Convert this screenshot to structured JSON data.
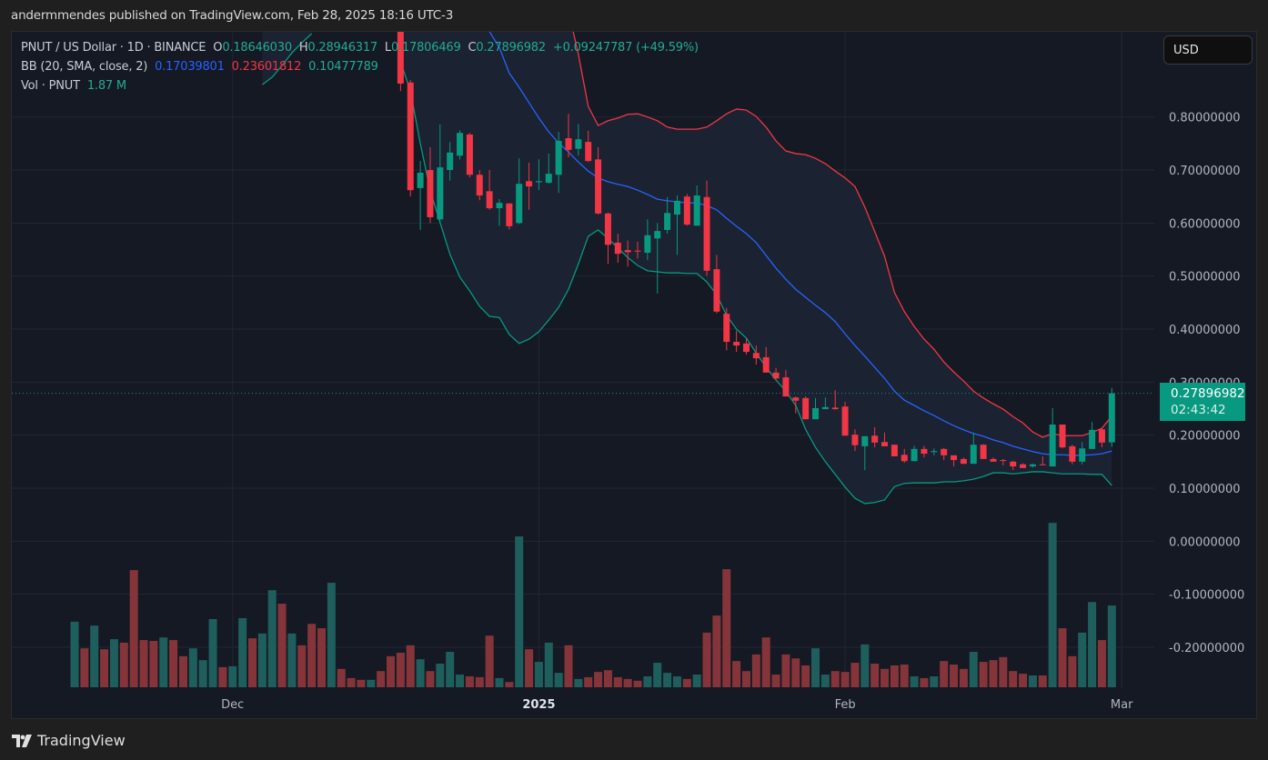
{
  "header": {
    "publisher": "andermmendes published on TradingView.com, Feb 28, 2025 18:16 UTC-3"
  },
  "legend": {
    "symbol": "PNUT / US Dollar · 1D · BINANCE",
    "o_label": "O",
    "o": "0.18646030",
    "h_label": "H",
    "h": "0.28946317",
    "l_label": "L",
    "l": "0.17806469",
    "c_label": "C",
    "c": "0.27896982",
    "change": "+0.09247787 (+49.59%)",
    "bb_label": "BB (20, SMA, close, 2)",
    "bb_basis": "0.17039801",
    "bb_upper": "0.23601812",
    "bb_lower": "0.10477789",
    "vol_label": "Vol · PNUT",
    "vol": "1.87 M"
  },
  "currency_button": "USD",
  "last_price": {
    "price": "0.27896982",
    "countdown": "02:43:42",
    "value": 0.27896982
  },
  "branding": {
    "name": "TradingView"
  },
  "colors": {
    "up": "#089981",
    "down": "#f23645",
    "vol_up": "#1e5f5d",
    "vol_down": "#853539",
    "bb_basis": "#2962ff",
    "bb_upper": "#f23645",
    "bb_lower": "#089981",
    "band_fill": "#1c2333"
  },
  "chart_data": {
    "type": "candlestick",
    "title": "PNUT / US Dollar · 1D · BINANCE",
    "ylim": [
      -0.25,
      0.96
    ],
    "y_ticks": [
      {
        "value": 0.8,
        "label": "0.80000000"
      },
      {
        "value": 0.7,
        "label": "0.70000000"
      },
      {
        "value": 0.6,
        "label": "0.60000000"
      },
      {
        "value": 0.5,
        "label": "0.50000000"
      },
      {
        "value": 0.4,
        "label": "0.40000000"
      },
      {
        "value": 0.3,
        "label": "0.30000000"
      },
      {
        "value": 0.2,
        "label": "0.20000000"
      },
      {
        "value": 0.1,
        "label": "0.10000000"
      },
      {
        "value": 0.0,
        "label": "0.00000000"
      },
      {
        "value": -0.1,
        "label": "-0.10000000"
      },
      {
        "value": -0.2,
        "label": "-0.20000000"
      }
    ],
    "x_ticks": [
      {
        "day": 16,
        "label": "Dec",
        "bold": false
      },
      {
        "day": 47,
        "label": "2025",
        "bold": true
      },
      {
        "day": 78,
        "label": "Feb",
        "bold": false
      },
      {
        "day": 106,
        "label": "Mar",
        "bold": false
      }
    ],
    "candle_offset": 33,
    "candles_ohlc": [
      [
        1.02,
        1.05,
        0.849,
        0.863
      ],
      [
        0.865,
        0.87,
        0.65,
        0.662
      ],
      [
        0.666,
        0.717,
        0.587,
        0.695
      ],
      [
        0.7,
        0.743,
        0.6,
        0.611
      ],
      [
        0.607,
        0.786,
        0.605,
        0.705
      ],
      [
        0.7,
        0.753,
        0.68,
        0.733
      ],
      [
        0.727,
        0.775,
        0.72,
        0.77
      ],
      [
        0.767,
        0.77,
        0.686,
        0.691
      ],
      [
        0.691,
        0.7,
        0.643,
        0.652
      ],
      [
        0.66,
        0.7,
        0.625,
        0.628
      ],
      [
        0.628,
        0.645,
        0.595,
        0.638
      ],
      [
        0.637,
        0.637,
        0.588,
        0.594
      ],
      [
        0.6,
        0.722,
        0.598,
        0.674
      ],
      [
        0.679,
        0.714,
        0.625,
        0.669
      ],
      [
        0.677,
        0.72,
        0.662,
        0.679
      ],
      [
        0.676,
        0.731,
        0.674,
        0.693
      ],
      [
        0.691,
        0.772,
        0.657,
        0.755
      ],
      [
        0.76,
        0.806,
        0.724,
        0.738
      ],
      [
        0.74,
        0.787,
        0.727,
        0.758
      ],
      [
        0.753,
        0.774,
        0.715,
        0.717
      ],
      [
        0.72,
        0.743,
        0.616,
        0.618
      ],
      [
        0.618,
        0.62,
        0.523,
        0.559
      ],
      [
        0.563,
        0.58,
        0.525,
        0.542
      ],
      [
        0.549,
        0.567,
        0.518,
        0.545
      ],
      [
        0.548,
        0.565,
        0.533,
        0.547
      ],
      [
        0.544,
        0.607,
        0.53,
        0.577
      ],
      [
        0.571,
        0.6,
        0.467,
        0.585
      ],
      [
        0.587,
        0.649,
        0.58,
        0.619
      ],
      [
        0.616,
        0.652,
        0.54,
        0.642
      ],
      [
        0.65,
        0.655,
        0.595,
        0.597
      ],
      [
        0.595,
        0.671,
        0.595,
        0.652
      ],
      [
        0.649,
        0.68,
        0.5,
        0.51
      ],
      [
        0.513,
        0.54,
        0.43,
        0.433
      ],
      [
        0.429,
        0.44,
        0.36,
        0.376
      ],
      [
        0.376,
        0.397,
        0.357,
        0.369
      ],
      [
        0.373,
        0.382,
        0.352,
        0.357
      ],
      [
        0.355,
        0.369,
        0.333,
        0.345
      ],
      [
        0.347,
        0.366,
        0.318,
        0.318
      ],
      [
        0.318,
        0.327,
        0.305,
        0.307
      ],
      [
        0.309,
        0.323,
        0.273,
        0.273
      ],
      [
        0.271,
        0.273,
        0.241,
        0.265
      ],
      [
        0.27,
        0.273,
        0.23,
        0.23
      ],
      [
        0.23,
        0.27,
        0.23,
        0.251
      ],
      [
        0.249,
        0.271,
        0.249,
        0.253
      ],
      [
        0.252,
        0.285,
        0.248,
        0.249
      ],
      [
        0.254,
        0.263,
        0.199,
        0.199
      ],
      [
        0.201,
        0.211,
        0.17,
        0.181
      ],
      [
        0.179,
        0.198,
        0.134,
        0.198
      ],
      [
        0.199,
        0.215,
        0.177,
        0.186
      ],
      [
        0.187,
        0.205,
        0.179,
        0.179
      ],
      [
        0.182,
        0.182,
        0.16,
        0.16
      ],
      [
        0.163,
        0.174,
        0.148,
        0.151
      ],
      [
        0.151,
        0.18,
        0.151,
        0.174
      ],
      [
        0.174,
        0.18,
        0.158,
        0.165
      ],
      [
        0.168,
        0.175,
        0.162,
        0.17
      ],
      [
        0.174,
        0.176,
        0.153,
        0.162
      ],
      [
        0.162,
        0.162,
        0.141,
        0.153
      ],
      [
        0.155,
        0.158,
        0.146,
        0.146
      ],
      [
        0.146,
        0.205,
        0.146,
        0.182
      ],
      [
        0.182,
        0.183,
        0.155,
        0.155
      ],
      [
        0.155,
        0.158,
        0.15,
        0.15
      ],
      [
        0.153,
        0.155,
        0.143,
        0.152
      ],
      [
        0.15,
        0.152,
        0.134,
        0.141
      ],
      [
        0.145,
        0.147,
        0.138,
        0.138
      ],
      [
        0.141,
        0.146,
        0.139,
        0.145
      ],
      [
        0.145,
        0.16,
        0.143,
        0.144
      ],
      [
        0.141,
        0.251,
        0.141,
        0.22
      ],
      [
        0.22,
        0.22,
        0.175,
        0.177
      ],
      [
        0.179,
        0.182,
        0.145,
        0.15
      ],
      [
        0.15,
        0.187,
        0.145,
        0.175
      ],
      [
        0.174,
        0.225,
        0.174,
        0.21
      ],
      [
        0.211,
        0.214,
        0.177,
        0.186
      ],
      [
        0.18646,
        0.28946,
        0.17806,
        0.27897
      ]
    ],
    "volume_M": [
      1.5,
      0.89,
      1.41,
      0.87,
      1.1,
      1.02,
      2.68,
      1.08,
      1.06,
      1.14,
      1.08,
      0.71,
      0.89,
      0.62,
      1.56,
      0.46,
      0.48,
      1.58,
      1.12,
      1.23,
      2.22,
      1.91,
      1.23,
      0.96,
      1.45,
      1.35,
      2.39,
      0.42,
      0.21,
      0.17,
      0.17,
      0.37,
      0.71,
      0.79,
      0.96,
      0.64,
      0.37,
      0.54,
      0.81,
      0.29,
      0.25,
      0.23,
      1.18,
      0.21,
      0.12,
      3.45,
      0.87,
      0.58,
      1.02,
      0.33,
      0.96,
      0.19,
      0.23,
      0.35,
      0.39,
      0.23,
      0.19,
      0.15,
      0.25,
      0.56,
      0.33,
      0.25,
      0.19,
      0.29,
      1.25,
      1.64,
      2.7,
      0.6,
      0.37,
      0.75,
      1.14,
      0.29,
      0.75,
      0.66,
      0.5,
      0.89,
      0.29,
      0.37,
      0.35,
      0.56,
      0.98,
      0.54,
      0.42,
      0.5,
      0.52,
      0.25,
      0.21,
      0.25,
      0.6,
      0.52,
      0.42,
      0.81,
      0.58,
      0.62,
      0.69,
      0.37,
      0.31,
      0.27,
      0.27,
      3.76,
      1.35,
      0.71,
      1.25,
      1.95,
      1.08,
      1.87
    ],
    "volume_up": [
      1,
      0,
      1,
      0,
      1,
      0,
      0,
      0,
      0,
      1,
      0,
      0,
      1,
      1,
      1,
      0,
      1,
      1,
      0,
      1,
      1,
      0,
      1,
      0,
      0,
      0,
      1,
      0,
      0,
      0,
      1,
      0,
      0,
      0,
      0,
      1,
      0,
      1,
      1,
      1,
      0,
      0,
      0,
      1,
      0,
      1,
      0,
      1,
      1,
      1,
      0,
      1,
      0,
      0,
      0,
      0,
      0,
      0,
      1,
      1,
      1,
      1,
      0,
      1,
      0,
      0,
      0,
      0,
      0,
      0,
      0,
      0,
      0,
      0,
      0,
      1,
      1,
      0,
      0,
      0,
      1,
      0,
      0,
      0,
      0,
      1,
      0,
      1,
      0,
      0,
      0,
      1,
      0,
      0,
      0,
      0,
      0,
      1,
      0,
      1,
      0,
      0,
      1,
      1,
      0,
      1
    ],
    "bb_lower": {
      "start": 19,
      "values": [
        0.861,
        0.875,
        0.897,
        0.921,
        0.94,
        0.957,
        null,
        null,
        null,
        null,
        null,
        null,
        null,
        null,
        0.904,
        0.849,
        0.75,
        0.661,
        0.601,
        0.541,
        0.498,
        0.472,
        0.443,
        0.424,
        0.422,
        0.39,
        0.373,
        0.381,
        0.395,
        0.417,
        0.441,
        0.475,
        0.523,
        0.575,
        0.587,
        0.571,
        0.553,
        0.535,
        0.52,
        0.51,
        0.508,
        0.506,
        0.506,
        0.505,
        0.505,
        0.489,
        0.465,
        0.426,
        0.4,
        0.383,
        0.355,
        0.328,
        0.304,
        0.283,
        0.256,
        0.211,
        0.177,
        0.15,
        0.126,
        0.102,
        0.081,
        0.071,
        0.073,
        0.078,
        0.103,
        0.109,
        0.11,
        0.11,
        0.11,
        0.112,
        0.112,
        0.114,
        0.117,
        0.122,
        0.129,
        0.129,
        0.127,
        0.129,
        0.131,
        0.131,
        0.129,
        0.127,
        0.127,
        0.127,
        0.126,
        0.126,
        0.105
      ]
    },
    "bb_basis": {
      "start": 42,
      "values": [
        0.961,
        0.931,
        0.883,
        0.856,
        0.827,
        0.798,
        0.772,
        0.751,
        0.734,
        0.715,
        0.698,
        0.685,
        0.678,
        0.673,
        0.669,
        0.662,
        0.654,
        0.645,
        0.642,
        0.64,
        0.638,
        0.638,
        0.633,
        0.625,
        0.609,
        0.594,
        0.58,
        0.563,
        0.539,
        0.515,
        0.494,
        0.475,
        0.46,
        0.445,
        0.431,
        0.414,
        0.391,
        0.369,
        0.349,
        0.328,
        0.307,
        0.283,
        0.266,
        0.256,
        0.246,
        0.237,
        0.227,
        0.218,
        0.21,
        0.203,
        0.198,
        0.191,
        0.186,
        0.179,
        0.174,
        0.169,
        0.165,
        0.163,
        0.163,
        0.162,
        0.162,
        0.163,
        0.165,
        0.17
      ]
    },
    "bb_upper": {
      "start": 50,
      "values": [
        1.0,
        0.918,
        0.82,
        0.784,
        0.793,
        0.798,
        0.805,
        0.806,
        0.8,
        0.793,
        0.781,
        0.777,
        0.777,
        0.777,
        0.781,
        0.793,
        0.806,
        0.815,
        0.813,
        0.801,
        0.781,
        0.755,
        0.736,
        0.731,
        0.729,
        0.722,
        0.712,
        0.698,
        0.685,
        0.669,
        0.63,
        0.584,
        0.537,
        0.469,
        0.433,
        0.405,
        0.381,
        0.362,
        0.338,
        0.319,
        0.302,
        0.283,
        0.27,
        0.259,
        0.249,
        0.235,
        0.223,
        0.206,
        0.196,
        0.203,
        0.199,
        0.199,
        0.199,
        0.205,
        0.213,
        0.236
      ]
    }
  }
}
